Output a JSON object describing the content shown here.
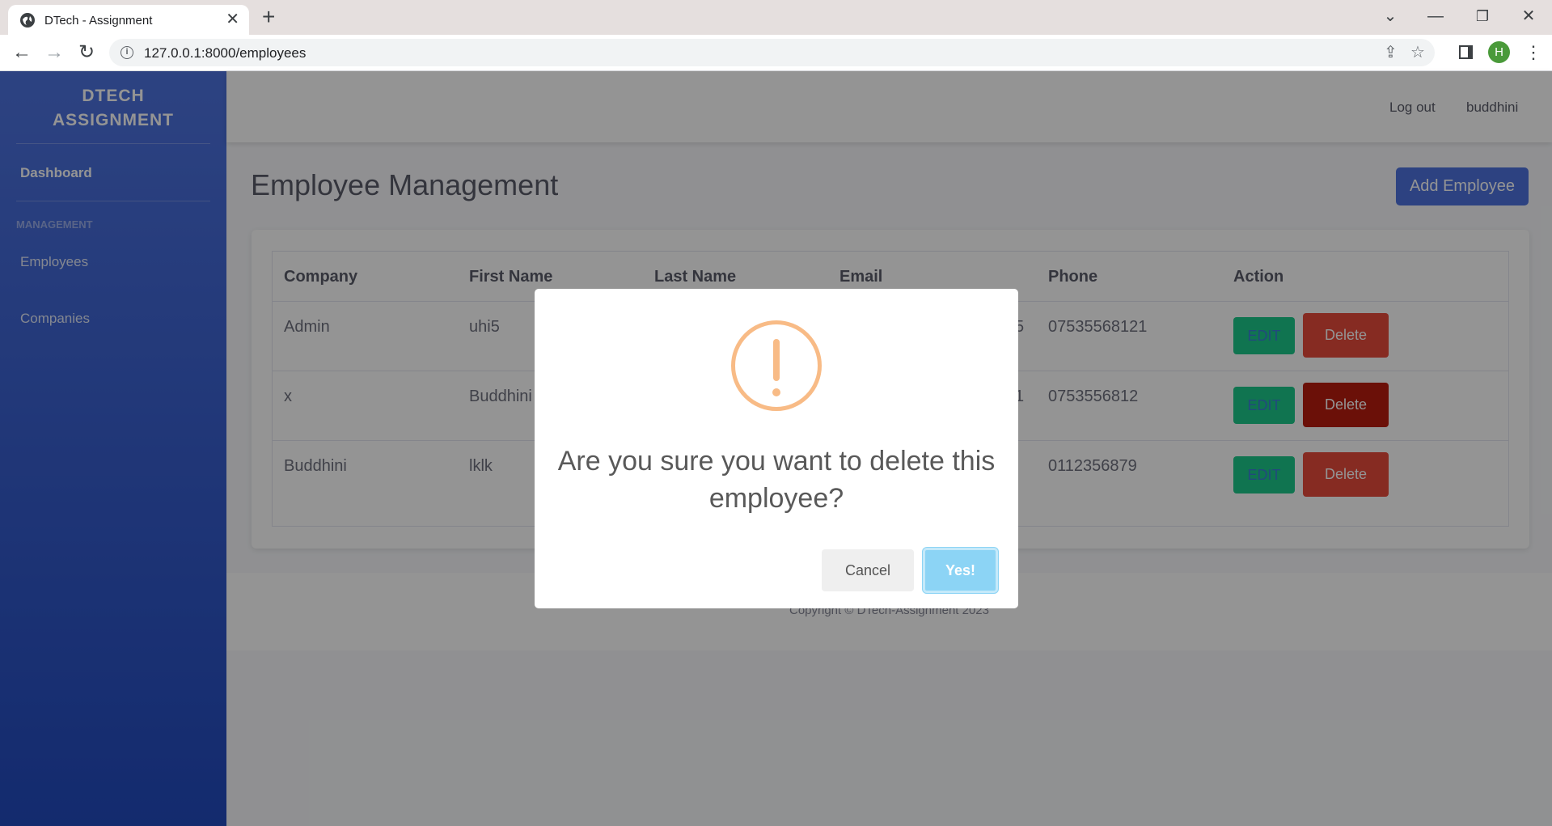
{
  "browser": {
    "tab_title": "DTech - Assignment",
    "url": "127.0.0.1:8000/employees",
    "profile_initial": "H"
  },
  "sidebar": {
    "brand_line1": "DTECH",
    "brand_line2": "ASSIGNMENT",
    "dashboard": "Dashboard",
    "section_heading": "MANAGEMENT",
    "items": [
      {
        "label": "Employees"
      },
      {
        "label": "Companies"
      }
    ]
  },
  "topbar": {
    "logout": "Log out",
    "username": "buddhini"
  },
  "main": {
    "title": "Employee Management",
    "add_button": "Add Employee"
  },
  "table": {
    "headers": [
      "Company",
      "First Name",
      "Last Name",
      "Email",
      "Phone",
      "Action"
    ],
    "rows": [
      {
        "company": "Admin",
        "first_name": "uhi5",
        "email_tail": "5",
        "phone": "07535568121"
      },
      {
        "company": "x",
        "first_name": "Buddhini",
        "email_tail": "1",
        "phone": "0753556812"
      },
      {
        "company": "Buddhini",
        "first_name": "lklk",
        "email_tail": "",
        "phone": "0112356879"
      }
    ],
    "edit_label": "EDIT",
    "delete_label": "Delete"
  },
  "footer": {
    "text": "Copyright © DTech-Assignment 2023"
  },
  "modal": {
    "line1": "Are you sure you want to delete this",
    "line2": "employee?",
    "cancel": "Cancel",
    "confirm": "Yes!",
    "icon": "warning-icon",
    "icon_color": "#f8bb86"
  },
  "colors": {
    "primary": "#4e73df",
    "success": "#1cc88a",
    "danger": "#e74a3b",
    "confirm": "#8cd4f5"
  }
}
